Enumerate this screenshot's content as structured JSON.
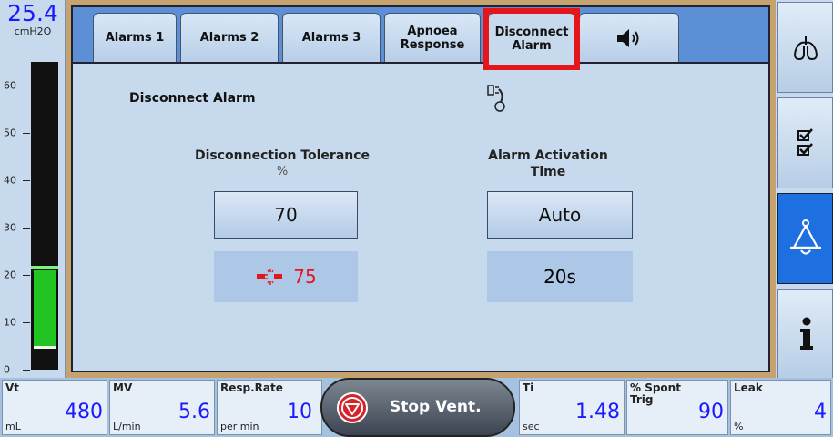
{
  "pressure": {
    "value": "25.4",
    "unit": "cmH2O",
    "ticks": [
      "60",
      "50",
      "40",
      "30",
      "20",
      "10",
      "0"
    ],
    "fill_level_cmH2O": 21,
    "peak_marker_cmH2O": 22,
    "baseline_marker_cmH2O": 5,
    "colors": {
      "fill": "#22c422",
      "gauge_bg": "#111111"
    }
  },
  "tabs": [
    {
      "label": "Alarms 1",
      "active": false
    },
    {
      "label": "Alarms 2",
      "active": false
    },
    {
      "label": "Alarms 3",
      "active": false
    },
    {
      "label": "Apnoea\nResponse",
      "active": false
    },
    {
      "label": "Disconnect\nAlarm",
      "active": true
    },
    {
      "label": "",
      "icon": "speaker-icon",
      "active": false
    }
  ],
  "main": {
    "heading": "Disconnect Alarm",
    "icon": "disconnected-tube-icon",
    "disconnection_tolerance": {
      "title": "Disconnection Tolerance",
      "unit": "%",
      "setting": "70",
      "measured": "75",
      "measured_icon": "disconnect-plug-icon",
      "measured_color": "#e4161b"
    },
    "alarm_activation": {
      "title": "Alarm Activation\nTime",
      "setting": "Auto",
      "measured": "20s"
    }
  },
  "sidebar": {
    "items": [
      {
        "icon": "lungs-icon",
        "active": false
      },
      {
        "icon": "checklist-icon",
        "active": false
      },
      {
        "icon": "alarm-bell-icon",
        "active": true
      },
      {
        "icon": "info-icon",
        "active": false
      }
    ]
  },
  "bottom": {
    "vt": {
      "label": "Vt",
      "value": "480",
      "unit": "mL"
    },
    "mv": {
      "label": "MV",
      "value": "5.6",
      "unit": "L/min"
    },
    "rr": {
      "label": "Resp.Rate",
      "value": "10",
      "unit": "per min"
    },
    "stop_button": "Stop Vent.",
    "ti": {
      "label": "Ti",
      "value": "1.48",
      "unit": "sec"
    },
    "spont": {
      "label": "% Spont\nTrig",
      "value": "90",
      "unit": ""
    },
    "leak": {
      "label": "Leak",
      "value": "4",
      "unit": "%"
    }
  },
  "colors": {
    "accent": "#1e6fe0",
    "highlight": "#e4161b",
    "value_blue": "#1a1aff"
  }
}
